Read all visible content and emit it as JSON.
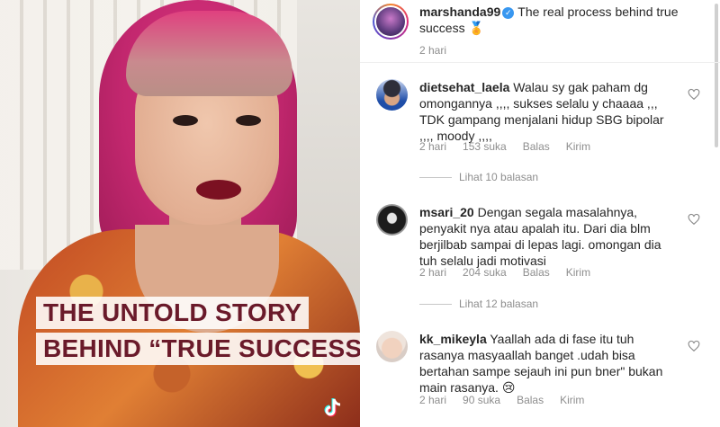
{
  "media": {
    "overlay_lines": [
      "THE UNTOLD STORY",
      "BEHIND “TRUE SUCCESS”"
    ],
    "watermark_icon": "tiktok-icon"
  },
  "post": {
    "username": "marshanda99",
    "verified_icon": "verified-badge-icon",
    "caption": "The real process behind true success",
    "caption_emoji": "🏅",
    "time": "2 hari"
  },
  "comments": [
    {
      "username": "dietsehat_laela",
      "text": "Walau sy gak paham dg omongannya ,,,, sukses selalu y chaaaa ,,, TDK gampang menjalani hidup SBG bipolar ,,,, moody ,,,,",
      "time": "2 hari",
      "likes": "153 suka",
      "reply_label": "Balas",
      "send_label": "Kirim",
      "view_replies": "Lihat 10 balasan"
    },
    {
      "username": "msari_20",
      "text": "Dengan segala masalahnya, penyakit nya atau apalah itu. Dari dia blm berjilbab sampai di lepas lagi. omongan dia tuh selalu jadi motivasi",
      "time": "2 hari",
      "likes": "204 suka",
      "reply_label": "Balas",
      "send_label": "Kirim",
      "view_replies": "Lihat 12 balasan"
    },
    {
      "username": "kk_mikeyla",
      "text": "Yaallah ada di fase itu tuh rasanya masyaallah banget .udah bisa bertahan sampe sejauh ini pun bner\" bukan main rasanya.",
      "emoji": "😢",
      "time": "2 hari",
      "likes": "90 suka",
      "reply_label": "Balas",
      "send_label": "Kirim"
    }
  ],
  "colors": {
    "text": "#262626",
    "muted": "#8e8e8e",
    "verified": "#3897f0",
    "overlay_text": "#6a1a2a"
  }
}
